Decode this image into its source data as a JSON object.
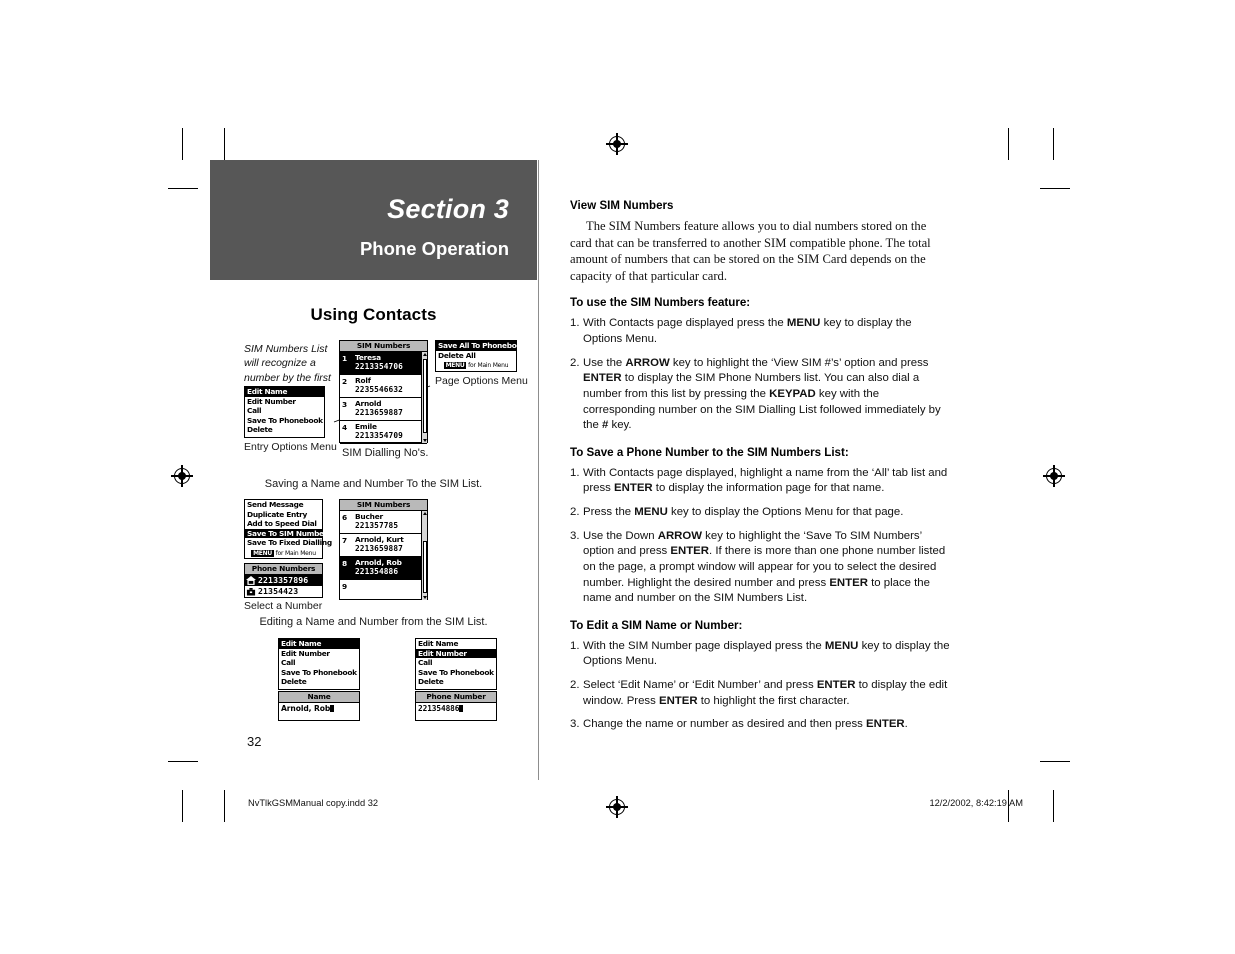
{
  "section": {
    "title": "Section 3",
    "subtitle": "Phone Operation",
    "topic": "Using Contacts"
  },
  "left_column": {
    "note_italic": "SIM Numbers List will recognize a number by the first few digits.",
    "captions": {
      "entry_options": "Entry Options Menu",
      "sim_dialling": "SIM Dialling No's.",
      "page_options": "Page Options Menu",
      "saving_heading": "Saving a Name and Number To the SIM List.",
      "select_a_number": "Select a Number",
      "editing_heading": "Editing a Name and Number from the SIM List."
    },
    "entry_options_menu": {
      "items": [
        "Edit Name",
        "Edit Number",
        "Call",
        "Save To Phonebook",
        "Delete"
      ],
      "selected_index": 0
    },
    "sim_dialling_list": {
      "title": "SIM Numbers",
      "rows": [
        {
          "index": "1",
          "name": "Teresa",
          "number": "2213354706",
          "selected": true
        },
        {
          "index": "2",
          "name": "Rolf",
          "number": "2235546632",
          "selected": false
        },
        {
          "index": "3",
          "name": "Arnold",
          "number": "2213659887",
          "selected": false
        },
        {
          "index": "4",
          "name": "Emile",
          "number": "2213354709",
          "selected": false
        }
      ]
    },
    "page_options_menu": {
      "items": [
        "Save All To Phonebook",
        "Delete All"
      ],
      "selected_index": 0,
      "footer_key": "MENU",
      "footer_text": "for Main Menu"
    },
    "page_menu_long": {
      "items": [
        "Send Message",
        "Duplicate Entry",
        "Add to Speed Dial",
        "Save To SIM Numbers",
        "Save To Fixed Dialling"
      ],
      "selected_index": 3,
      "footer_key": "MENU",
      "footer_text": "for Main Menu"
    },
    "phone_numbers_picker": {
      "title": "Phone Numbers",
      "rows": [
        {
          "icon": "home-phone-icon",
          "number": "2213357896",
          "selected": true
        },
        {
          "icon": "work-phone-icon",
          "number": "21354423",
          "selected": false
        }
      ]
    },
    "sim_save_list": {
      "title": "SIM Numbers",
      "rows": [
        {
          "index": "6",
          "name": "Bucher",
          "number": "221357785",
          "selected": false
        },
        {
          "index": "7",
          "name": "Arnold, Kurt",
          "number": "2213659887",
          "selected": false
        },
        {
          "index": "8",
          "name": "Arnold, Rob",
          "number": "221354886",
          "selected": true
        },
        {
          "index": "9",
          "name": "",
          "number": "",
          "selected": false
        }
      ]
    },
    "edit_menu_name": {
      "items": [
        "Edit Name",
        "Edit Number",
        "Call",
        "Save To Phonebook",
        "Delete"
      ],
      "selected_index": 0
    },
    "edit_menu_number": {
      "items": [
        "Edit Name",
        "Edit Number",
        "Call",
        "Save To Phonebook",
        "Delete"
      ],
      "selected_index": 1
    },
    "edit_name_window": {
      "title": "Name",
      "value": "Arnold, Rob"
    },
    "edit_number_window": {
      "title": "Phone Number",
      "value": "221354886"
    }
  },
  "right_column": {
    "heading": "View SIM Numbers",
    "intro": "The SIM Numbers feature allows you to dial numbers stored on the card that can be transferred to another SIM compatible phone. The total amount of numbers that can be stored on the SIM Card depends on the capacity of that particular card.",
    "proc1_heading": "To use the SIM Numbers feature:",
    "proc1_steps": [
      "With Contacts page displayed press the <b>MENU</b> key to display the Options Menu.",
      "Use the <b>ARROW</b> key to highlight the ‘View SIM #’s’ option and press <b>ENTER</b> to display the SIM Phone Numbers list.  You can also dial a number from this list by pressing the <b>KEYPAD</b> key with the corresponding number on the SIM Dialling List followed immediately by the <b>#</b> key."
    ],
    "proc2_heading": "To Save a Phone Number to the SIM Numbers List:",
    "proc2_steps": [
      "With Contacts page displayed, highlight a name from the ‘All’ tab list and press <b>ENTER</b> to display the information page for that name.",
      "Press the <b>MENU</b> key to display the Options Menu for that page.",
      "Use the Down <b>ARROW</b> key to highlight the ‘Save To SIM Numbers’ option and press <b>ENTER</b>.  If there is more than one phone number listed on the page, a prompt window will appear for you to select the desired number.  Highlight the desired number and press <b>ENTER</b> to place the name and number on the SIM Numbers List."
    ],
    "proc3_heading": "To Edit a SIM Name or Number:",
    "proc3_steps": [
      "With the SIM Number page displayed press the <b>MENU</b> key to display the Options Menu.",
      "Select ‘Edit Name’ or ‘Edit Number’ and press <b>ENTER</b> to display the edit window.  Press <b>ENTER</b> to highlight the first character.",
      "Change the name or number as desired and then press <b>ENTER</b>."
    ]
  },
  "footer": {
    "page_number": "32",
    "file_info": "NvTlkGSMManual copy.indd   32",
    "timestamp": "12/2/2002, 8:42:19 AM"
  },
  "colors": {
    "banner": "#575757",
    "device_title_bar": "#b9b9b9",
    "rule": "#8d8d8d"
  }
}
